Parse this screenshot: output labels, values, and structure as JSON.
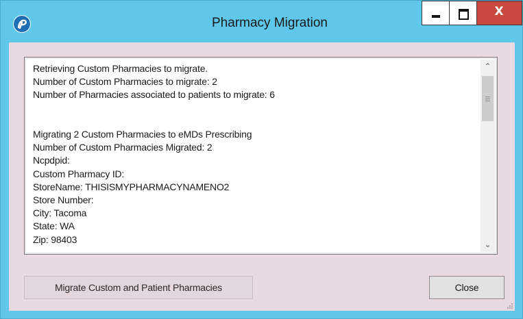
{
  "window": {
    "title": "Pharmacy Migration",
    "controls": {
      "minimize_icon": "minimize-icon",
      "maximize_icon": "maximize-icon",
      "close_label": "X"
    },
    "app_icon": "app-logo-icon"
  },
  "log": {
    "lines": [
      "Retrieving Custom Pharmacies to migrate.",
      "Number of Custom Pharmacies to migrate: 2",
      "Number of Pharmacies associated to patients to migrate: 6",
      "",
      "",
      "Migrating 2 Custom Pharmacies to eMDs Prescribing",
      "Number of Custom Pharmacies Migrated: 2",
      "Ncpdpid:",
      "Custom Pharmacy ID:",
      "StoreName: THISISMYPHARMACYNAMENO2",
      "Store Number:",
      "City: Tacoma",
      "State: WA",
      "Zip: 98403"
    ]
  },
  "buttons": {
    "migrate_label": "Migrate Custom and Patient Pharmacies",
    "close_label": "Close"
  },
  "colors": {
    "titlebar": "#5fc8ea",
    "client": "#e8d9e2",
    "close_button": "#c84a3e"
  }
}
